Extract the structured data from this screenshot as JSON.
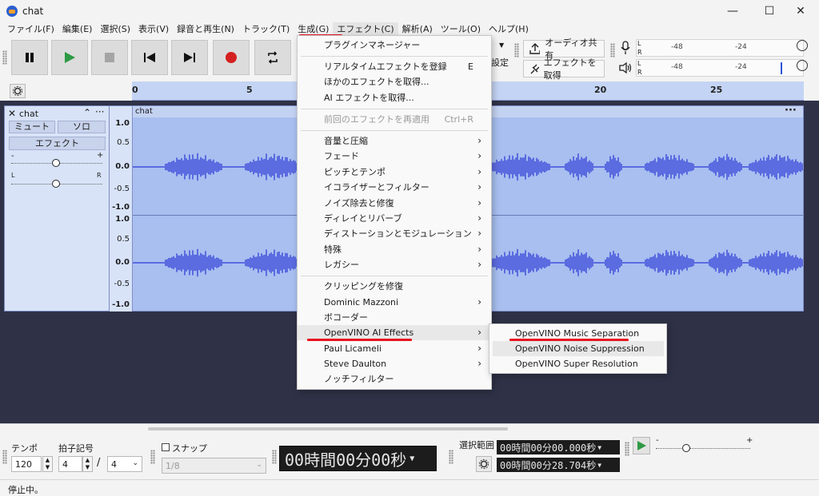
{
  "window": {
    "title": "chat",
    "minimize": "—",
    "maximize": "☐",
    "close": "✕"
  },
  "menubar": [
    "ファイル(F)",
    "編集(E)",
    "選択(S)",
    "表示(V)",
    "録音と再生(N)",
    "トラック(T)",
    "生成(G)",
    "エフェクト(C)",
    "解析(A)",
    "ツール(O)",
    "ヘルプ(H)"
  ],
  "toolbar": {
    "share_audio": "オーディオ共有",
    "get_effects": "エフェクトを取得",
    "settings_partial": "設定",
    "meter_ticks": [
      "-48",
      "-24"
    ],
    "meter_l": "L",
    "meter_r": "R"
  },
  "ruler": {
    "ticks": [
      "0",
      "5",
      "20",
      "25"
    ]
  },
  "track": {
    "name": "chat",
    "mute": "ミュート",
    "solo": "ソロ",
    "effects": "エフェクト",
    "gain_minus": "-",
    "gain_plus": "+",
    "pan_l": "L",
    "pan_r": "R",
    "clip_name": "chat",
    "scale_top": [
      "1.0",
      "0.5",
      "0.0",
      "-0.5",
      "-1.0"
    ],
    "scale_bottom": [
      "1.0",
      "0.5",
      "0.0",
      "-0.5",
      "-1.0"
    ]
  },
  "effect_menu": {
    "items": [
      {
        "label": "プラグインマネージャー",
        "shortcut": "",
        "submenu": false,
        "disabled": false
      },
      {
        "label": "リアルタイムエフェクトを登録",
        "shortcut": "E",
        "submenu": false,
        "disabled": false
      },
      {
        "label": "ほかのエフェクトを取得...",
        "shortcut": "",
        "submenu": false,
        "disabled": false
      },
      {
        "label": "AI エフェクトを取得...",
        "shortcut": "",
        "submenu": false,
        "disabled": false
      },
      {
        "label": "前回のエフェクトを再適用",
        "shortcut": "Ctrl+R",
        "submenu": false,
        "disabled": true
      },
      {
        "label": "音量と圧縮",
        "shortcut": "",
        "submenu": true,
        "disabled": false
      },
      {
        "label": "フェード",
        "shortcut": "",
        "submenu": true,
        "disabled": false
      },
      {
        "label": "ピッチとテンポ",
        "shortcut": "",
        "submenu": true,
        "disabled": false
      },
      {
        "label": "イコライザーとフィルター",
        "shortcut": "",
        "submenu": true,
        "disabled": false
      },
      {
        "label": "ノイズ除去と修復",
        "shortcut": "",
        "submenu": true,
        "disabled": false
      },
      {
        "label": "ディレイとリバーブ",
        "shortcut": "",
        "submenu": true,
        "disabled": false
      },
      {
        "label": "ディストーションとモジュレーション",
        "shortcut": "",
        "submenu": true,
        "disabled": false
      },
      {
        "label": "特殊",
        "shortcut": "",
        "submenu": true,
        "disabled": false
      },
      {
        "label": "レガシー",
        "shortcut": "",
        "submenu": true,
        "disabled": false
      },
      {
        "label": "クリッピングを修復",
        "shortcut": "",
        "submenu": false,
        "disabled": false
      },
      {
        "label": "Dominic Mazzoni",
        "shortcut": "",
        "submenu": true,
        "disabled": false
      },
      {
        "label": "ボコーダー",
        "shortcut": "",
        "submenu": false,
        "disabled": false
      },
      {
        "label": "OpenVINO AI Effects",
        "shortcut": "",
        "submenu": true,
        "disabled": false
      },
      {
        "label": "Paul Licameli",
        "shortcut": "",
        "submenu": true,
        "disabled": false
      },
      {
        "label": "Steve Daulton",
        "shortcut": "",
        "submenu": true,
        "disabled": false
      },
      {
        "label": "ノッチフィルター",
        "shortcut": "",
        "submenu": false,
        "disabled": false
      }
    ],
    "arrow": "›"
  },
  "submenu": {
    "items": [
      "OpenVINO Music Separation",
      "OpenVINO Noise Suppression",
      "OpenVINO Super Resolution"
    ]
  },
  "bottom": {
    "tempo_label": "テンポ",
    "tempo_value": "120",
    "timesig_label": "拍子記号",
    "timesig_num": "4",
    "timesig_slash": "/",
    "timesig_den": "4",
    "snap_label": "スナップ",
    "snap_value": "1/8",
    "time_display": "00時間00分00秒",
    "selection_label": "選択範囲",
    "sel_start": "00時間00分00.000秒",
    "sel_end": "00時間00分28.704秒",
    "speed_minus": "-",
    "speed_plus": "+"
  },
  "status": {
    "text": "停止中。"
  }
}
